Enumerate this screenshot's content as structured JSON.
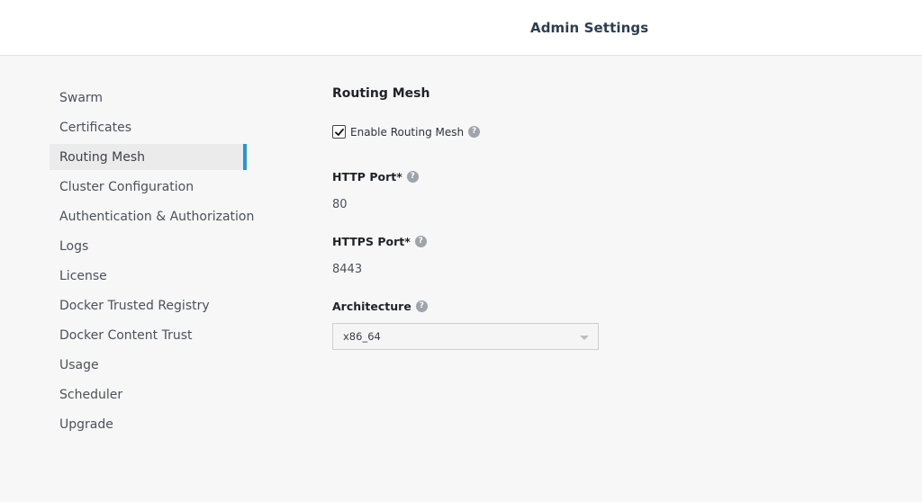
{
  "header": {
    "title": "Admin Settings"
  },
  "sidebar": {
    "items": [
      {
        "label": "Swarm"
      },
      {
        "label": "Certificates"
      },
      {
        "label": "Routing Mesh",
        "active": true
      },
      {
        "label": "Cluster Configuration"
      },
      {
        "label": "Authentication & Authorization"
      },
      {
        "label": "Logs"
      },
      {
        "label": "License"
      },
      {
        "label": "Docker Trusted Registry"
      },
      {
        "label": "Docker Content Trust"
      },
      {
        "label": "Usage"
      },
      {
        "label": "Scheduler"
      },
      {
        "label": "Upgrade"
      }
    ]
  },
  "routing_mesh": {
    "section_title": "Routing Mesh",
    "enable_label": "Enable Routing Mesh",
    "enabled": true,
    "http_port_label": "HTTP Port*",
    "http_port_value": "80",
    "https_port_label": "HTTPS Port*",
    "https_port_value": "8443",
    "architecture_label": "Architecture",
    "architecture_value": "x86_64"
  },
  "help_glyph": "?",
  "colors": {
    "accent": "#1d9ad6",
    "active_bg": "#ebebeb",
    "page_bg": "#f7f7f7"
  }
}
